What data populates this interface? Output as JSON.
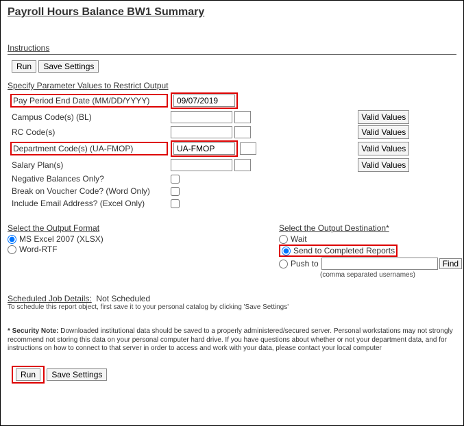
{
  "title": "Payroll Hours Balance BW1 Summary",
  "instructions_label": "Instructions",
  "buttons": {
    "run": "Run",
    "save_settings": "Save Settings",
    "valid_values": "Valid Values",
    "find": "Find"
  },
  "parameters_heading": "Specify Parameter Values to Restrict Output",
  "params": {
    "pay_period_end": {
      "label": "Pay Period End Date (MM/DD/YYYY)",
      "value": "09/07/2019"
    },
    "campus_codes": {
      "label": "Campus Code(s) (BL)",
      "value": ""
    },
    "rc_codes": {
      "label": "RC Code(s)",
      "value": ""
    },
    "dept_codes": {
      "label": "Department Code(s) (UA-FMOP)",
      "value": "UA-FMOP"
    },
    "salary_plans": {
      "label": "Salary Plan(s)",
      "value": ""
    },
    "neg_balances": {
      "label": "Negative Balances Only?",
      "checked": false
    },
    "break_voucher": {
      "label": "Break on Voucher Code? (Word Only)",
      "checked": false
    },
    "include_email": {
      "label": "Include Email Address? (Excel Only)",
      "checked": false
    }
  },
  "output_format": {
    "heading": "Select the Output Format",
    "options": {
      "xlsx": "MS Excel 2007 (XLSX)",
      "word": "Word-RTF"
    },
    "selected": "xlsx"
  },
  "output_destination": {
    "heading": "Select the Output Destination*",
    "options": {
      "wait": "Wait",
      "send": "Send to Completed Reports",
      "push": "Push to"
    },
    "selected": "send",
    "push_value": "",
    "push_note": "(comma separated usernames)"
  },
  "scheduled": {
    "heading": "Scheduled Job Details:",
    "status": "Not Scheduled",
    "note": "To schedule this report object, first save it to your personal catalog by clicking 'Save Settings'"
  },
  "security_note": {
    "label": "* Security Note:",
    "text": "Downloaded institutional data should be saved to a properly administered/secured server. Personal workstations may not strongly recommend not storing this data on your personal computer hard drive. If you have questions about whether or not your department data, and for instructions on how to connect to that server in order to access and work with your data, please contact your local computer"
  }
}
